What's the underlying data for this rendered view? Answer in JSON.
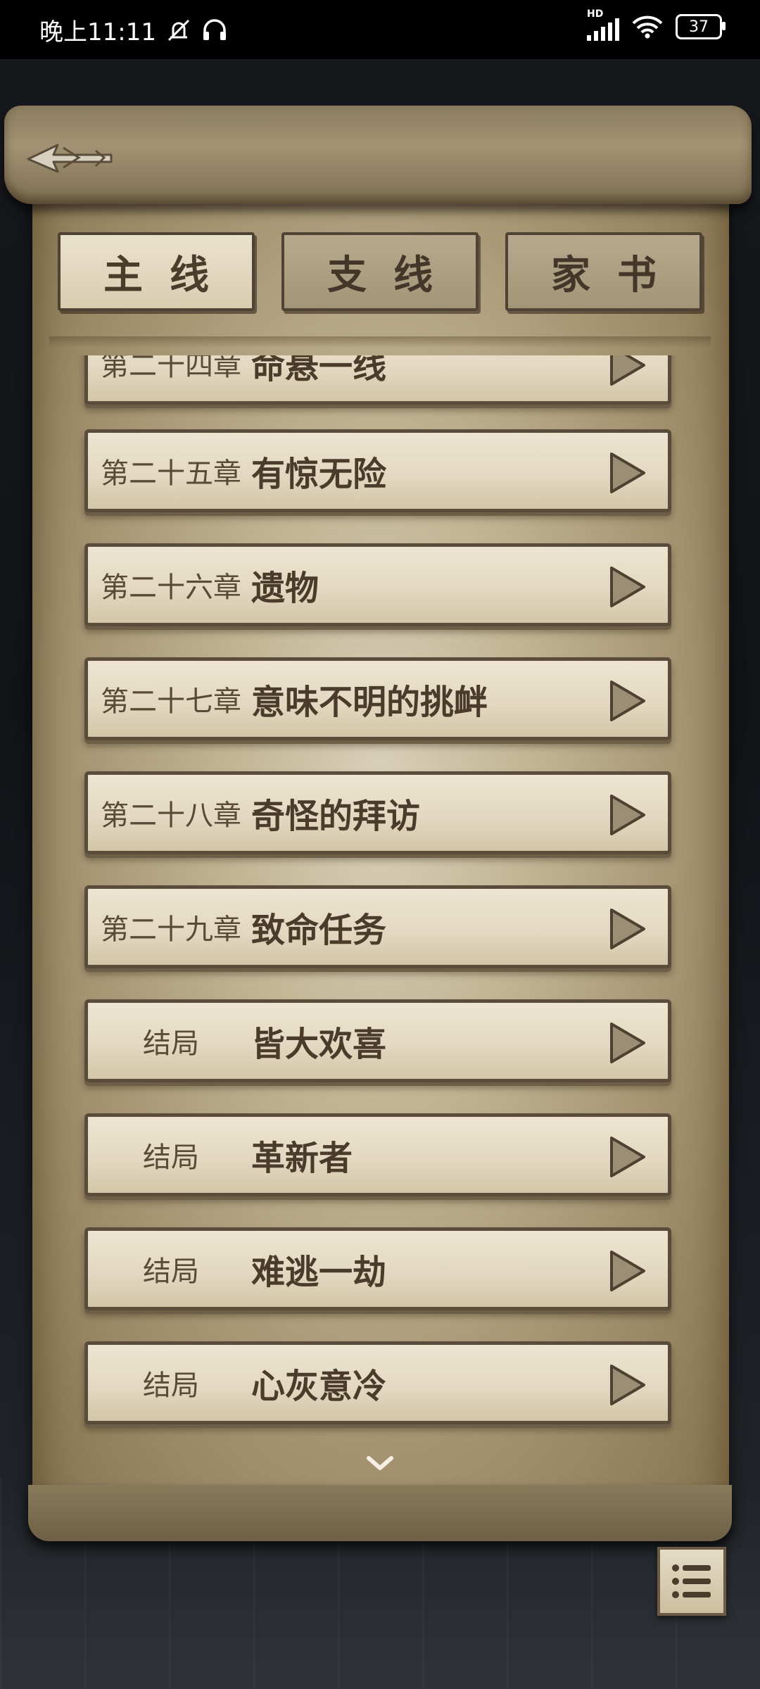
{
  "status_bar": {
    "time": "晚上11:11",
    "network_label": "HD",
    "battery": "37"
  },
  "tabs": [
    {
      "label": "主线",
      "active": true
    },
    {
      "label": "支线",
      "active": false
    },
    {
      "label": "家书",
      "active": false
    }
  ],
  "chapters": [
    {
      "prefix": "第二十四章",
      "title": "命悬一线"
    },
    {
      "prefix": "第二十五章",
      "title": "有惊无险"
    },
    {
      "prefix": "第二十六章",
      "title": "遗物"
    },
    {
      "prefix": "第二十七章",
      "title": "意味不明的挑衅"
    },
    {
      "prefix": "第二十八章",
      "title": "奇怪的拜访"
    },
    {
      "prefix": "第二十九章",
      "title": "致命任务"
    },
    {
      "prefix": "结局",
      "title": "皆大欢喜"
    },
    {
      "prefix": "结局",
      "title": "革新者"
    },
    {
      "prefix": "结局",
      "title": "难逃一劫"
    },
    {
      "prefix": "结局",
      "title": "心灰意冷"
    }
  ],
  "colors": {
    "parchment": "#c2b595",
    "button_face": "#e3d9c1",
    "ink": "#4a3b2b",
    "background": "#0f1013"
  },
  "icons": {
    "back": "arrow-left-icon",
    "play": "play-triangle-icon",
    "more": "chevron-down-icon",
    "menu": "list-menu-icon"
  }
}
